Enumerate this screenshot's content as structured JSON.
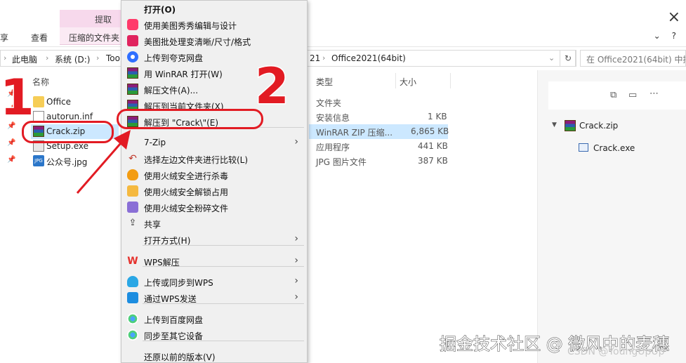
{
  "ribbon": {
    "context_tab_label": "提取",
    "tabs": [
      "享",
      "查看",
      "压缩的文件夹"
    ],
    "close_glyph": "×"
  },
  "address": {
    "segments": [
      "此电脑",
      "系统 (D:)",
      "Too",
      "21",
      "Office2021(64bit)"
    ],
    "search_placeholder": "在 Office2021(64bit) 中搜"
  },
  "columns": {
    "name": "名称",
    "type": "类型",
    "size": "大小"
  },
  "files": [
    {
      "name": "Office",
      "type": "文件夹",
      "size": "",
      "icon": "folder-icon"
    },
    {
      "name": "autorun.inf",
      "type": "安装信息",
      "size": "1 KB",
      "icon": "file-icon"
    },
    {
      "name": "Crack.zip",
      "type": "WinRAR ZIP 压缩...",
      "size": "6,865 KB",
      "icon": "winrar-icon",
      "selected": true
    },
    {
      "name": "Setup.exe",
      "type": "应用程序",
      "size": "441 KB",
      "icon": "exe-icon"
    },
    {
      "name": "公众号.jpg",
      "type": "JPG 图片文件",
      "size": "387 KB",
      "icon": "jpg-icon"
    }
  ],
  "preview": {
    "archive": "Crack.zip",
    "child": "Crack.exe"
  },
  "context_menu": {
    "items": [
      {
        "label": "打开(O)",
        "bold": true,
        "icon": ""
      },
      {
        "label": "使用美图秀秀编辑与设计",
        "icon": "meitu-icon"
      },
      {
        "label": "美图批处理变清晰/尺寸/格式",
        "icon": "meitu-batch-icon"
      },
      {
        "label": "上传到夸克网盘",
        "icon": "quark-icon"
      },
      {
        "label": "用 WinRAR 打开(W)",
        "icon": "winrar-icon"
      },
      {
        "label": "解压文件(A)...",
        "icon": "winrar-icon"
      },
      {
        "label": "解压到当前文件夹(X)",
        "icon": "winrar-icon"
      },
      {
        "label": "解压到 \"Crack\\\"(E)",
        "icon": "winrar-icon"
      },
      {
        "label": "7-Zip",
        "icon": "",
        "submenu": true
      },
      {
        "label": "选择左边文件夹进行比较(L)",
        "icon": "compare-icon"
      },
      {
        "label": "使用火绒安全进行杀毒",
        "icon": "huorong-icon"
      },
      {
        "label": "使用火绒安全解锁占用",
        "icon": "huorong-unlock-icon"
      },
      {
        "label": "使用火绒安全粉碎文件",
        "icon": "huorong-shred-icon"
      },
      {
        "label": "共享",
        "icon": "share-icon"
      },
      {
        "label": "打开方式(H)",
        "icon": "",
        "submenu": true
      },
      {
        "label": "WPS解压",
        "icon": "wps-icon",
        "submenu": true
      },
      {
        "label": "上传或同步到WPS",
        "icon": "wps-cloud-icon",
        "submenu": true
      },
      {
        "label": "通过WPS发送",
        "icon": "wps-send-icon",
        "submenu": true
      },
      {
        "label": "上传到百度网盘",
        "icon": "baidu-icon"
      },
      {
        "label": "同步至其它设备",
        "icon": "baidu-sync-icon"
      },
      {
        "label": "还原以前的版本(V)",
        "icon": ""
      }
    ],
    "arrow_glyph": "›"
  },
  "annotations": {
    "step1": "1",
    "step2": "2",
    "color": "#e21b23"
  },
  "watermark": {
    "main": "掘金技术社区 @ 微风中的麦穗",
    "csdn": "CSDN @YoungUpUp"
  }
}
